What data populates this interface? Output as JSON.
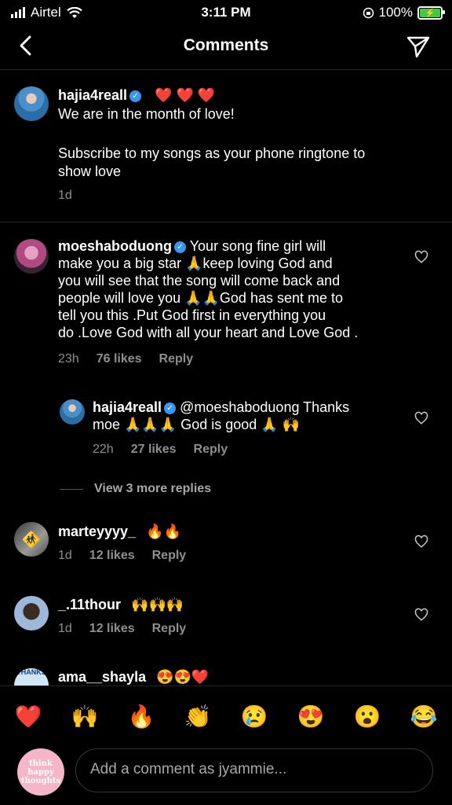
{
  "status_bar": {
    "carrier": "Airtel",
    "time": "3:11 PM",
    "battery": "100%"
  },
  "header": {
    "title": "Comments"
  },
  "caption": {
    "username": "hajia4reall",
    "emojis": "❤️ ❤️ ❤️",
    "line1": "We are in the month of love!",
    "line2": "Subscribe to my songs as your phone ringtone to",
    "line3": "show love",
    "time": "1d"
  },
  "comments": [
    {
      "username": "moeshaboduong",
      "lines": [
        "Your song fine girl will",
        "make you a big star 🙏keep loving God and",
        "you will see that the song will come back and",
        "people will love you 🙏🙏God has sent me to",
        "tell you this .Put God first in everything you",
        "do .Love God with all your heart and Love God ."
      ],
      "time": "23h",
      "likes": "76 likes",
      "reply": "Reply"
    },
    {
      "username": "hajia4reall",
      "lines": [
        "@moeshaboduong Thanks",
        "moe 🙏🙏🙏 God is good 🙏 🙌"
      ],
      "time": "22h",
      "likes": "27 likes",
      "reply": "Reply"
    },
    {
      "username": "marteyyyy_",
      "emojis": "🔥🔥",
      "time": "1d",
      "likes": "12 likes",
      "reply": "Reply"
    },
    {
      "username": "_.11thour",
      "emojis": "🙌🙌🙌",
      "time": "1d",
      "likes": "12 likes",
      "reply": "Reply"
    },
    {
      "username": "ama__shayla",
      "emojis": "😍😍❤️",
      "avatar_text": "THANKS"
    }
  ],
  "view_more": "View 3 more replies",
  "emoji_bar": [
    "❤️",
    "🙌",
    "🔥",
    "👏",
    "😢",
    "😍",
    "😮",
    "😂"
  ],
  "composer": {
    "placeholder": "Add a comment as jyammie...",
    "avatar_text_1": "think happy",
    "avatar_text_2": "thoughts"
  },
  "colors": {
    "background": "#000000",
    "verified": "#3897f0",
    "secondary_text": "#8e8e8e",
    "battery": "#3ecb3e"
  }
}
